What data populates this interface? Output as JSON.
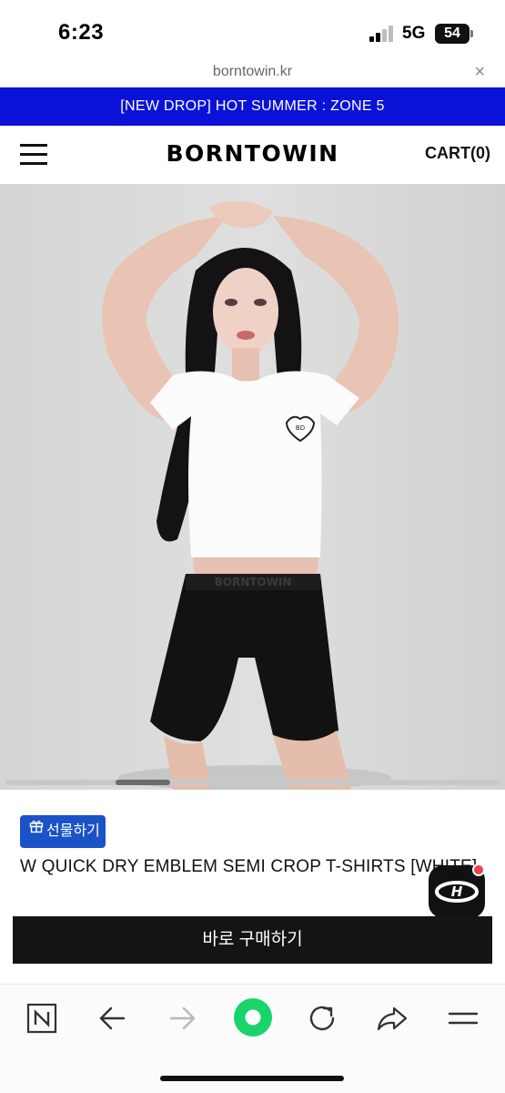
{
  "status_bar": {
    "time": "6:23",
    "network": "5G",
    "battery": "54"
  },
  "browser": {
    "url": "borntowin.kr",
    "close_symbol": "×"
  },
  "promo_banner": {
    "text": "[NEW DROP] HOT SUMMER : ZONE 5"
  },
  "header": {
    "logo": "BORNTOWIN",
    "cart_label": "CART(0)"
  },
  "hero": {
    "emblem_text": "BD",
    "waistband_text": "BORNTOWIN"
  },
  "product": {
    "gift_label": "선물하기",
    "title": "W QUICK DRY EMBLEM SEMI CROP T-SHIRTS [WHITE]",
    "buy_label": "바로 구매하기",
    "badge_letter": "H"
  },
  "colors": {
    "promo": "#0b12d8",
    "gift": "#1a53c8",
    "buy": "#141414",
    "browser_home": "#19d46a",
    "badge_dot": "#e8414a"
  },
  "icons": [
    "menu-icon",
    "gift-icon",
    "n-icon",
    "back-arrow-icon",
    "forward-arrow-icon",
    "home-icon",
    "reload-icon",
    "share-icon",
    "menu-lines-icon"
  ]
}
